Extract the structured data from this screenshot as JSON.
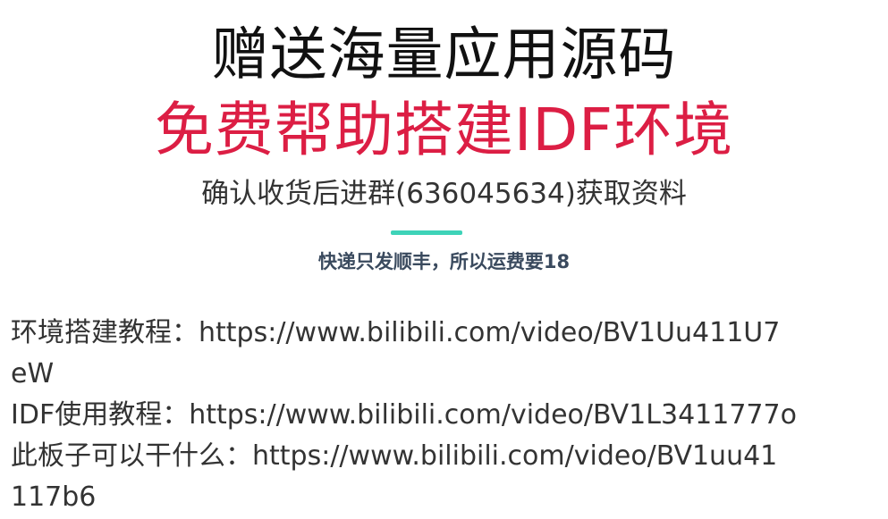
{
  "header": {
    "title": "赠送海量应用源码",
    "highlight": "免费帮助搭建IDF环境",
    "subtitle": "确认收货后进群(636045634)获取资料",
    "accent_color": "#3ed3b8",
    "highlight_color": "#dc1e44"
  },
  "notice": {
    "shipping": "快递只发顺丰，所以运费要18"
  },
  "links": [
    {
      "label": "环境搭建教程：",
      "url_part1": "https://www.bilibili.com/video/BV1Uu411U7",
      "url_part2": "eW"
    },
    {
      "label": "IDF使用教程：",
      "url_part1": "https://www.bilibili.com/video/BV1L3411777o",
      "url_part2": ""
    },
    {
      "label": "此板子可以干什么：",
      "url_part1": "https://www.bilibili.com/video/BV1uu41",
      "url_part2": "117b6"
    }
  ]
}
